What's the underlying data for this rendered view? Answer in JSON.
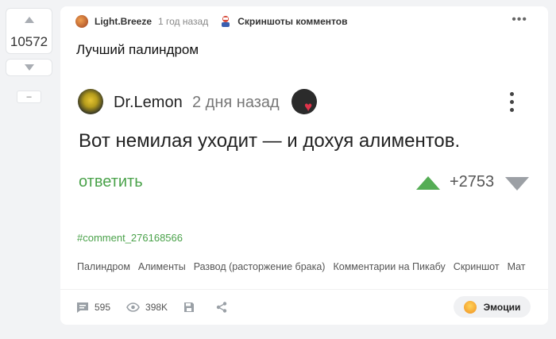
{
  "rating": {
    "value": "10572",
    "minus_label": "–"
  },
  "post": {
    "author": "Light.Breeze",
    "time": "1 год назад",
    "community": "Скриншоты комментов",
    "menu_icon": "dots-horizontal-icon",
    "title": "Лучший палиндром"
  },
  "screenshot": {
    "author": "Dr.Lemon",
    "time": "2 дня назад",
    "text": "Вот немилая уходит — и дохуя алиментов.",
    "reply_label": "ответить",
    "score": "+2753",
    "colors": {
      "reply": "#4aa24a",
      "upvote": "#55ad55",
      "downvote": "#9ca0a5"
    }
  },
  "comment_link": "#comment_276168566",
  "tags": [
    "Палиндром",
    "Алименты",
    "Развод (расторжение брака)",
    "Комментарии на Пикабу",
    "Скриншот",
    "Мат"
  ],
  "footer": {
    "comments": "595",
    "views": "398K",
    "emotions_label": "Эмоции"
  }
}
